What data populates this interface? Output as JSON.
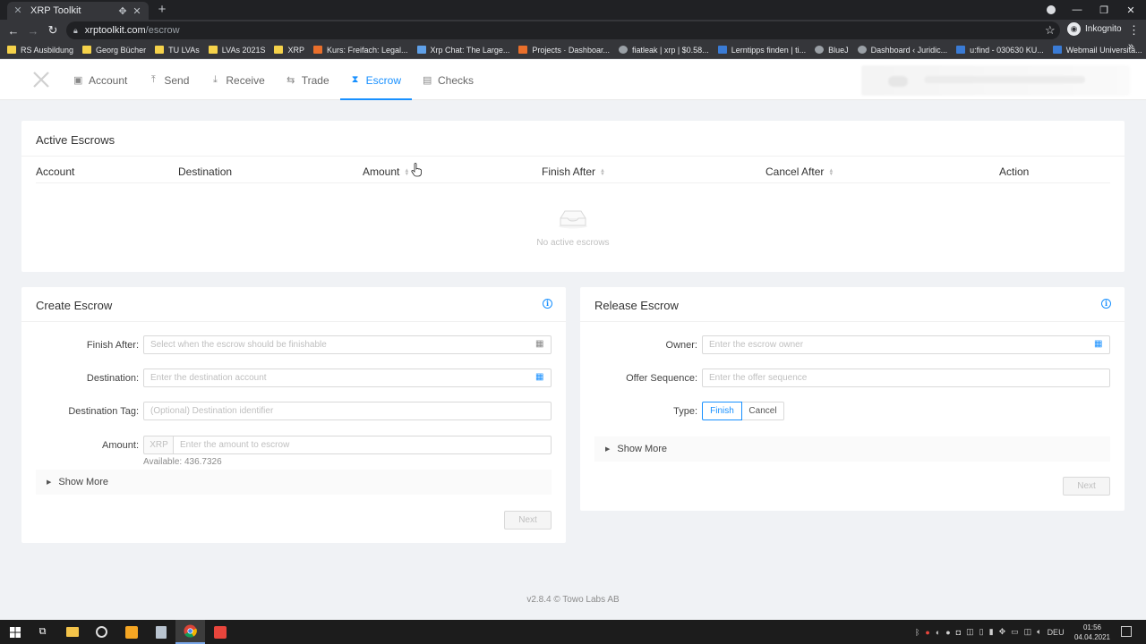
{
  "browser": {
    "tab_title": "XRP Toolkit",
    "url_host": "xrptoolkit.com",
    "url_path": "/escrow",
    "profile_label": "Inkognito",
    "bookmarks": [
      {
        "label": "RS Ausbildung",
        "icon": "folder"
      },
      {
        "label": "Georg Bücher",
        "icon": "folder"
      },
      {
        "label": "TU LVAs",
        "icon": "folder"
      },
      {
        "label": "LVAs 2021S",
        "icon": "folder"
      },
      {
        "label": "XRP",
        "icon": "folder"
      },
      {
        "label": "Kurs: Freifach: Legal...",
        "icon": "site"
      },
      {
        "label": "Xrp Chat: The Large...",
        "icon": "site"
      },
      {
        "label": "Projects · Dashboar...",
        "icon": "gitlab"
      },
      {
        "label": "fiatleak | xrp | $0.58...",
        "icon": "site"
      },
      {
        "label": "Lerntipps finden | ti...",
        "icon": "site"
      },
      {
        "label": "BlueJ",
        "icon": "site"
      },
      {
        "label": "Dashboard ‹ Juridic...",
        "icon": "wordpress"
      },
      {
        "label": "u:find - 030630 KU...",
        "icon": "site"
      },
      {
        "label": "Webmail Universitä...",
        "icon": "site"
      }
    ]
  },
  "nav": {
    "items": [
      {
        "label": "Account",
        "icon": "account-icon",
        "active": false
      },
      {
        "label": "Send",
        "icon": "send-icon",
        "active": false
      },
      {
        "label": "Receive",
        "icon": "receive-icon",
        "active": false
      },
      {
        "label": "Trade",
        "icon": "trade-icon",
        "active": false
      },
      {
        "label": "Escrow",
        "icon": "hourglass-icon",
        "active": true
      },
      {
        "label": "Checks",
        "icon": "checks-icon",
        "active": false
      }
    ]
  },
  "active_escrows": {
    "title": "Active Escrows",
    "columns": {
      "account": "Account",
      "destination": "Destination",
      "amount": "Amount",
      "finish_after": "Finish After",
      "cancel_after": "Cancel After",
      "action": "Action"
    },
    "empty_text": "No active escrows"
  },
  "create_escrow": {
    "title": "Create Escrow",
    "finish_after_label": "Finish After:",
    "finish_after_placeholder": "Select when the escrow should be finishable",
    "destination_label": "Destination:",
    "destination_placeholder": "Enter the destination account",
    "destination_tag_label": "Destination Tag:",
    "destination_tag_placeholder": "(Optional) Destination identifier",
    "amount_label": "Amount:",
    "amount_currency": "XRP",
    "amount_placeholder": "Enter the amount to escrow",
    "available": "Available: 436.7326",
    "show_more": "Show More",
    "next": "Next"
  },
  "release_escrow": {
    "title": "Release Escrow",
    "owner_label": "Owner:",
    "owner_placeholder": "Enter the escrow owner",
    "sequence_label": "Offer Sequence:",
    "sequence_placeholder": "Enter the offer sequence",
    "type_label": "Type:",
    "type_finish": "Finish",
    "type_cancel": "Cancel",
    "selected_type": "Finish",
    "show_more": "Show More",
    "next": "Next"
  },
  "footer": "v2.8.4 © Towo Labs AB",
  "taskbar": {
    "time": "01:56",
    "date": "04.04.2021",
    "language": "DEU"
  },
  "colors": {
    "accent": "#1890ff",
    "page_bg": "#f0f2f5",
    "chrome_dark": "#202124"
  }
}
